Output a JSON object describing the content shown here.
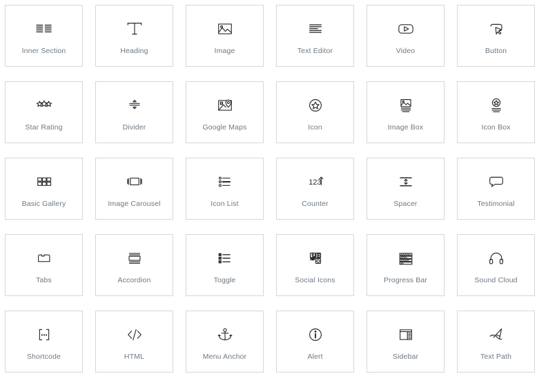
{
  "panel": {
    "title": "Elementor Widgets Panel",
    "columns": 6,
    "rows": 5,
    "card": {
      "background": "#ffffff",
      "border_color": "#d6d6d6",
      "icon_color": "#2b2b2b",
      "label_color": "#6d7882"
    }
  },
  "widgets": [
    {
      "label": "Inner Section",
      "icon": "inner-section-icon"
    },
    {
      "label": "Heading",
      "icon": "heading-t-icon"
    },
    {
      "label": "Image",
      "icon": "image-picture-icon"
    },
    {
      "label": "Text Editor",
      "icon": "text-lines-icon"
    },
    {
      "label": "Video",
      "icon": "video-play-icon"
    },
    {
      "label": "Button",
      "icon": "button-cursor-icon"
    },
    {
      "label": "Star Rating",
      "icon": "three-stars-icon"
    },
    {
      "label": "Divider",
      "icon": "divider-arrows-icon"
    },
    {
      "label": "Google Maps",
      "icon": "map-pin-icon"
    },
    {
      "label": "Icon",
      "icon": "star-in-circle-icon"
    },
    {
      "label": "Image Box",
      "icon": "image-with-lines-icon"
    },
    {
      "label": "Icon Box",
      "icon": "star-circle-with-lines-icon"
    },
    {
      "label": "Basic Gallery",
      "icon": "grid-squares-icon"
    },
    {
      "label": "Image Carousel",
      "icon": "carousel-frame-icon"
    },
    {
      "label": "Icon List",
      "icon": "bullet-list-icon"
    },
    {
      "label": "Counter",
      "icon": "counter-123-arrow-icon"
    },
    {
      "label": "Spacer",
      "icon": "spacer-updown-arrow-icon"
    },
    {
      "label": "Testimonial",
      "icon": "speech-bubble-icon"
    },
    {
      "label": "Tabs",
      "icon": "folder-tabs-icon"
    },
    {
      "label": "Accordion",
      "icon": "accordion-panel-icon"
    },
    {
      "label": "Toggle",
      "icon": "toggle-plus-list-icon"
    },
    {
      "label": "Social Icons",
      "icon": "social-networks-icon"
    },
    {
      "label": "Progress Bar",
      "icon": "progress-bars-icon"
    },
    {
      "label": "Sound Cloud",
      "icon": "headphones-icon"
    },
    {
      "label": "Shortcode",
      "icon": "shortcode-brackets-icon"
    },
    {
      "label": "HTML",
      "icon": "code-angle-brackets-icon"
    },
    {
      "label": "Menu Anchor",
      "icon": "anchor-icon"
    },
    {
      "label": "Alert",
      "icon": "info-circle-icon"
    },
    {
      "label": "Sidebar",
      "icon": "sidebar-layout-icon"
    },
    {
      "label": "Text Path",
      "icon": "text-path-pen-icon"
    }
  ]
}
